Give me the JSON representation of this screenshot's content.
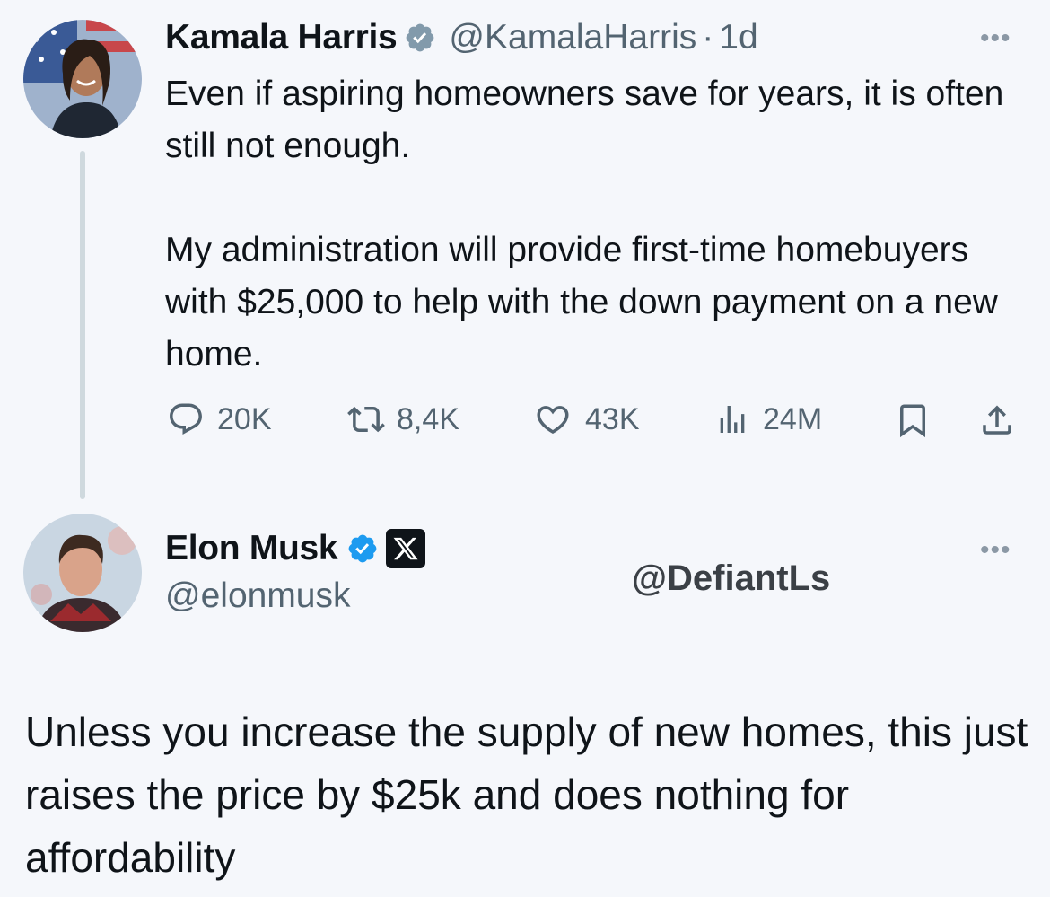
{
  "tweet1": {
    "author_name": "Kamala Harris",
    "handle": "@KamalaHarris",
    "separator": "·",
    "time": "1d",
    "text": "Even if aspiring homeowners save for years, it is often still not enough.\n\nMy administration will provide first-time homebuyers with $25,000 to help with the down payment on a new home.",
    "metrics": {
      "replies": "20K",
      "reposts": "8,4K",
      "likes": "43K",
      "views": "24M"
    },
    "icons": [
      "verified-badge-icon",
      "more-icon",
      "reply-icon",
      "repost-icon",
      "like-icon",
      "views-icon",
      "bookmark-icon",
      "share-icon"
    ]
  },
  "tweet2": {
    "author_name": "Elon Musk",
    "handle": "@elonmusk",
    "badge_letter": "X",
    "text": "Unless you increase the supply of new homes, this just raises the price by $25k and does nothing for affordability",
    "icons": [
      "verified-badge-icon",
      "x-affiliate-badge-icon",
      "more-icon"
    ]
  },
  "watermark": "@DefiantLs",
  "colors": {
    "background": "#f5f7fb",
    "text": "#0f1419",
    "muted": "#536471",
    "verified_blue": "#1d9bf0",
    "verified_gray": "#829aab",
    "thread_line": "#cfd9de"
  }
}
